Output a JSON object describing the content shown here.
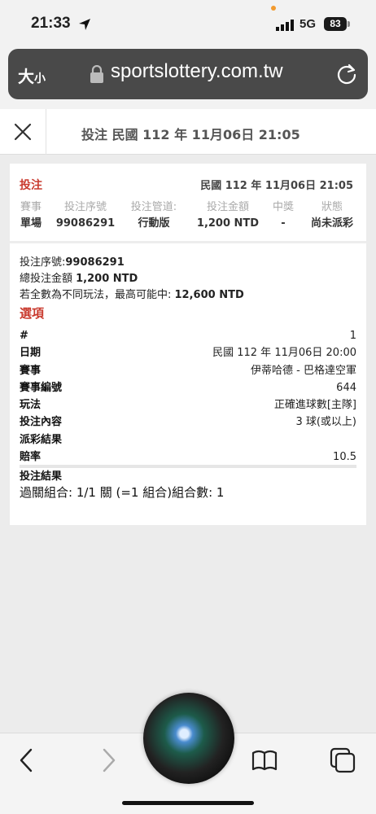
{
  "status_bar": {
    "time": "21:33",
    "network": "5G",
    "battery": "83"
  },
  "browser": {
    "text_size_label": "大",
    "text_size_small": "小",
    "url": "sportslottery.com.tw"
  },
  "page_header": {
    "title": "投注 民國 112 年 11月06日 21:05"
  },
  "card": {
    "label": "投注",
    "date": "民國 112 年 11月06日 21:05",
    "summary_headers": [
      "賽事",
      "投注序號",
      "投注管道:",
      "投注金額",
      "中獎",
      "狀態"
    ],
    "summary_values": [
      "單場",
      "99086291",
      "行動版",
      "1,200 NTD",
      "-",
      "尚未派彩"
    ],
    "serial_label": "投注序號:",
    "serial_value": "99086291",
    "total_label": "總投注金額 ",
    "total_value": "1,200 NTD",
    "max_label": "若全數為不同玩法，最高可能中: ",
    "max_value": "12,600 NTD",
    "options_title": "選項",
    "details": [
      {
        "key": "#",
        "value": "1"
      },
      {
        "key": "日期",
        "value": "民國 112 年 11月06日 20:00"
      },
      {
        "key": "賽事",
        "value": "伊蒂哈德 - 巴格達空軍"
      },
      {
        "key": "賽事編號",
        "value": "644"
      },
      {
        "key": "玩法",
        "value": "正確進球數[主隊]"
      },
      {
        "key": "投注內容",
        "value": "3 球(或以上)"
      },
      {
        "key": "派彩結果",
        "value": ""
      },
      {
        "key": "賠率",
        "value": "10.5"
      },
      {
        "key": "投注結果",
        "value": ""
      }
    ],
    "combo": "過關組合: 1/1 關 (=1 組合)組合數: 1"
  }
}
